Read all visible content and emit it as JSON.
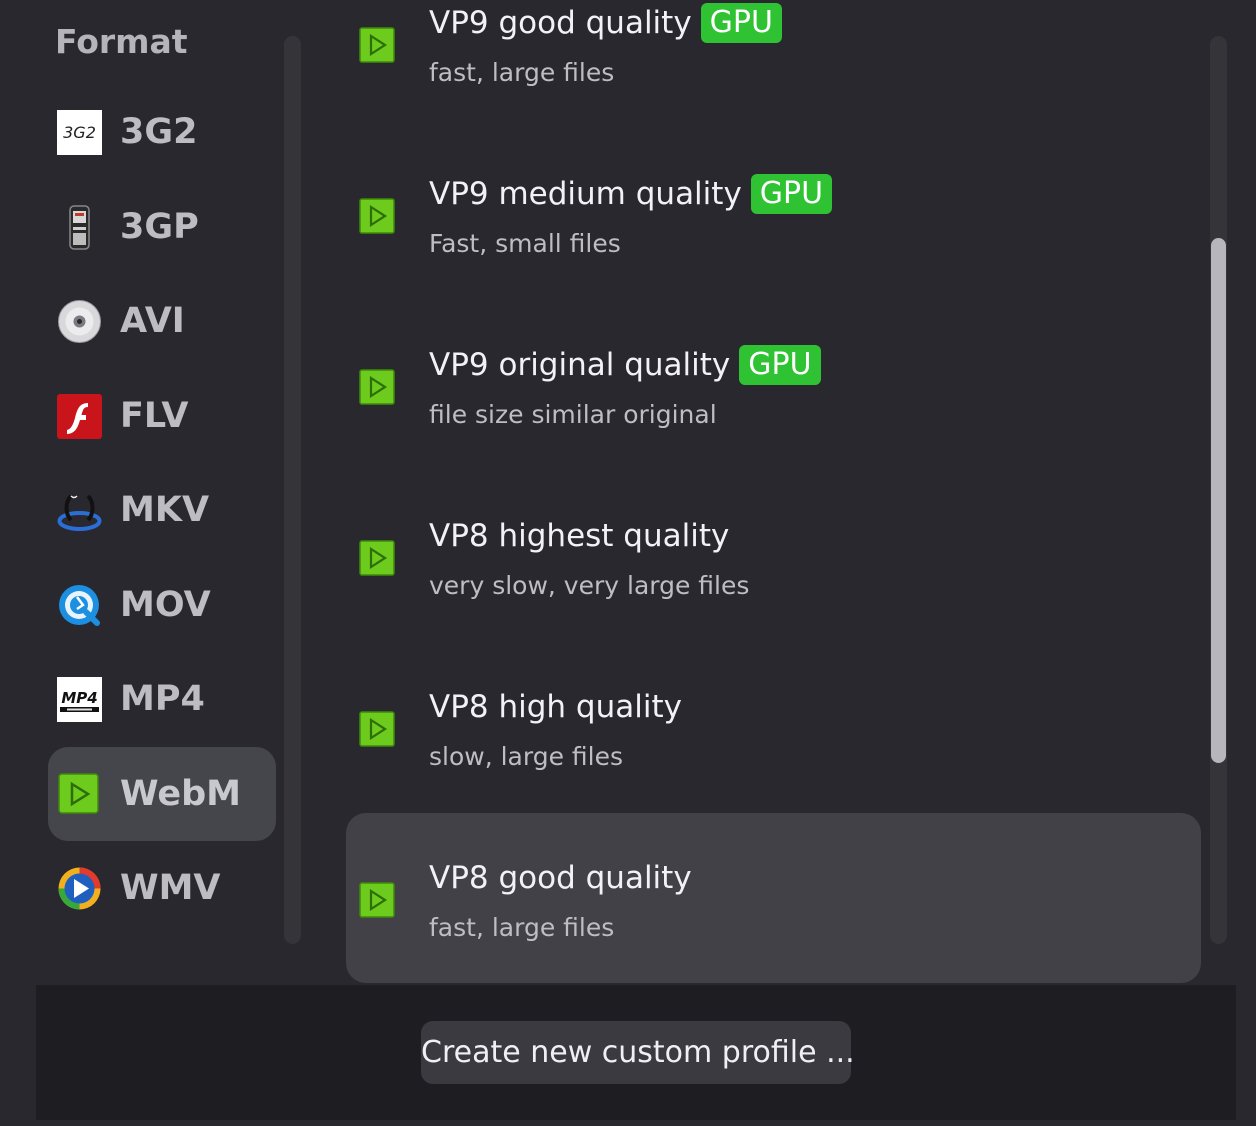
{
  "sidebar": {
    "title": "Format",
    "items": [
      {
        "label": "3G2",
        "icon": "3g2-icon"
      },
      {
        "label": "3GP",
        "icon": "3gp-phone-icon"
      },
      {
        "label": "AVI",
        "icon": "avi-disc-icon"
      },
      {
        "label": "FLV",
        "icon": "flash-icon"
      },
      {
        "label": "MKV",
        "icon": "mkv-icon"
      },
      {
        "label": "MOV",
        "icon": "quicktime-icon"
      },
      {
        "label": "MP4",
        "icon": "mp4-icon"
      },
      {
        "label": "WebM",
        "icon": "webm-icon",
        "selected": true
      },
      {
        "label": "WMV",
        "icon": "windows-media-icon"
      }
    ],
    "icon_texts": {
      "3g2": "3G2",
      "mp4": "MP4"
    }
  },
  "profiles": {
    "gpu_label": "GPU",
    "items": [
      {
        "name": "VP9 good quality",
        "desc": "fast, large files",
        "gpu": true
      },
      {
        "name": "VP9 medium quality",
        "desc": "Fast, small files",
        "gpu": true
      },
      {
        "name": "VP9 original quality",
        "desc": "file size similar original",
        "gpu": true
      },
      {
        "name": "VP8 highest quality",
        "desc": "very slow, very large files",
        "gpu": false
      },
      {
        "name": "VP8 high quality",
        "desc": "slow, large files",
        "gpu": false
      },
      {
        "name": "VP8 good quality",
        "desc": "fast, large files",
        "gpu": false,
        "selected": true
      }
    ]
  },
  "footer": {
    "create_button": "Create new custom profile ..."
  },
  "colors": {
    "background": "#28282e",
    "selected": "#45454c",
    "gpu_badge": "#2fc233",
    "webm_green": "#6ccb1c"
  }
}
